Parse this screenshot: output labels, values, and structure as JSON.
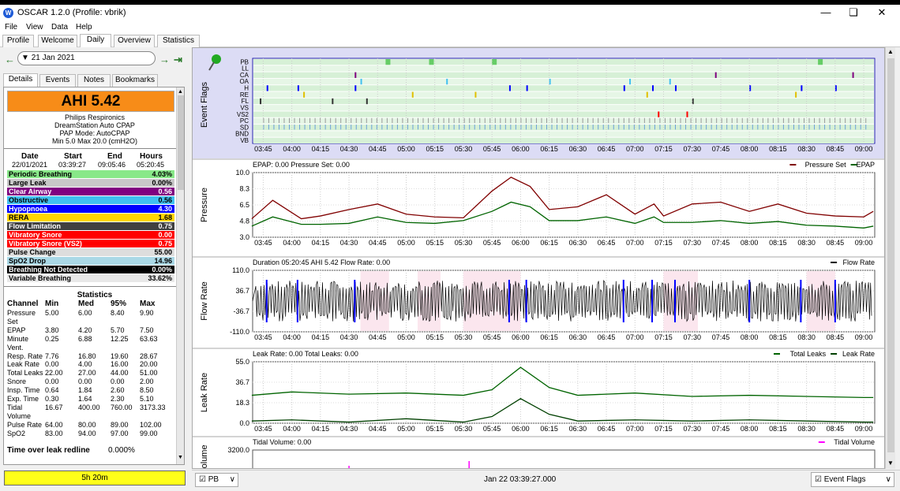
{
  "window": {
    "title": "OSCAR 1.2.0 (Profile: vbrik)",
    "icon": "oscar-app-icon"
  },
  "menu": [
    "File",
    "View",
    "Data",
    "Help"
  ],
  "tabs": [
    "Profile",
    "Welcome",
    "Daily",
    "Overview",
    "Statistics"
  ],
  "active_tab": "Daily",
  "date_nav": {
    "date": "21 Jan 2021"
  },
  "subtabs": [
    "Details",
    "Events",
    "Notes",
    "Bookmarks"
  ],
  "details": {
    "ahi": "AHI 5.42",
    "machine": [
      "Philips Respironics",
      "DreamStation Auto CPAP",
      "PAP Mode: AutoCPAP",
      "Min 5.0 Max 20.0 (cmH2O)"
    ],
    "session_headers": [
      "Date",
      "Start",
      "End",
      "Hours"
    ],
    "session_values": [
      "22/01/2021",
      "03:39:27",
      "09:05:46",
      "05:20:45"
    ],
    "events": [
      {
        "name": "Periodic Breathing",
        "value": "4.03%",
        "bg": "#88e888",
        "fg": "#000000"
      },
      {
        "name": "Large Leak",
        "value": "0.00%",
        "bg": "#c8c8c8",
        "fg": "#000000"
      },
      {
        "name": "Clear Airway",
        "value": "0.56",
        "bg": "#800080",
        "fg": "#ffffff"
      },
      {
        "name": "Obstructive",
        "value": "0.56",
        "bg": "#40c0f0",
        "fg": "#000000"
      },
      {
        "name": "Hypopnoea",
        "value": "4.30",
        "bg": "#0000ff",
        "fg": "#ffffff"
      },
      {
        "name": "RERA",
        "value": "1.68",
        "bg": "#ffd700",
        "fg": "#000000"
      },
      {
        "name": "Flow Limitation",
        "value": "0.75",
        "bg": "#404040",
        "fg": "#ffffff"
      },
      {
        "name": "Vibratory Snore",
        "value": "0.00",
        "bg": "#ff0000",
        "fg": "#ffffff"
      },
      {
        "name": "Vibratory Snore (VS2)",
        "value": "0.75",
        "bg": "#ff0000",
        "fg": "#ffffff"
      },
      {
        "name": "Pulse Change",
        "value": "55.00",
        "bg": "#dddddd",
        "fg": "#000000"
      },
      {
        "name": "SpO2 Drop",
        "value": "14.96",
        "bg": "#aad8e6",
        "fg": "#000000"
      },
      {
        "name": "Breathing Not Detected",
        "value": "0.00%",
        "bg": "#000000",
        "fg": "#ffffff"
      },
      {
        "name": "Variable Breathing",
        "value": "33.62%",
        "bg": "#e8e8e8",
        "fg": "#000000"
      }
    ],
    "statistics_title": "Statistics",
    "stat_headers": [
      "Channel",
      "Min",
      "Med",
      "95%",
      "Max"
    ],
    "stats": [
      {
        "c": "Pressure",
        "min": "5.00",
        "med": "6.00",
        "p95": "8.40",
        "max": "9.90"
      },
      {
        "c": "Set",
        "min": "",
        "med": "",
        "p95": "",
        "max": ""
      },
      {
        "c": "EPAP",
        "min": "3.80",
        "med": "4.20",
        "p95": "5.70",
        "max": "7.50"
      },
      {
        "c": "Minute",
        "min": "0.25",
        "med": "6.88",
        "p95": "12.25",
        "max": "63.63"
      },
      {
        "c": "Vent.",
        "min": "",
        "med": "",
        "p95": "",
        "max": ""
      },
      {
        "c": "Resp. Rate",
        "min": "7.76",
        "med": "16.80",
        "p95": "19.60",
        "max": "28.67"
      },
      {
        "c": "Leak Rate",
        "min": "0.00",
        "med": "4.00",
        "p95": "16.00",
        "max": "20.00"
      },
      {
        "c": "Total Leaks",
        "min": "22.00",
        "med": "27.00",
        "p95": "44.00",
        "max": "51.00"
      },
      {
        "c": "Snore",
        "min": "0.00",
        "med": "0.00",
        "p95": "0.00",
        "max": "2.00"
      },
      {
        "c": "Insp. Time",
        "min": "0.64",
        "med": "1.84",
        "p95": "2.60",
        "max": "8.50"
      },
      {
        "c": "Exp. Time",
        "min": "0.30",
        "med": "1.64",
        "p95": "2.30",
        "max": "5.10"
      },
      {
        "c": "Tidal",
        "min": "16.67",
        "med": "400.00",
        "p95": "760.00",
        "max": "3173.33"
      },
      {
        "c": "Volume",
        "min": "",
        "med": "",
        "p95": "",
        "max": ""
      },
      {
        "c": "Pulse Rate",
        "min": "64.00",
        "med": "80.00",
        "p95": "89.00",
        "max": "102.00"
      },
      {
        "c": "SpO2",
        "min": "83.00",
        "med": "94.00",
        "p95": "97.00",
        "max": "99.00"
      }
    ],
    "leak_redline_label": "Time over leak redline",
    "leak_redline_value": "0.000%",
    "duration": "5h 20m"
  },
  "time_ticks": [
    "03:45",
    "04:00",
    "04:15",
    "04:30",
    "04:45",
    "05:00",
    "05:15",
    "05:30",
    "05:45",
    "06:00",
    "06:15",
    "06:30",
    "06:45",
    "07:00",
    "07:15",
    "07:30",
    "07:45",
    "08:00",
    "08:15",
    "08:30",
    "08:45",
    "09:00"
  ],
  "event_flags": {
    "ylabel": "Event Flags",
    "rows": [
      "PB",
      "LL",
      "CA",
      "OA",
      "H",
      "RE",
      "FL",
      "VS",
      "VS2",
      "PC",
      "SD",
      "BND",
      "VB"
    ]
  },
  "chart_data": [
    {
      "type": "line",
      "ylabel": "Pressure",
      "header_left": "EPAP: 0.00 Pressure Set: 0.00",
      "yticks": [
        "10.0",
        "8.3",
        "6.5",
        "4.8",
        "3.0"
      ],
      "ylim": [
        3.0,
        10.0
      ],
      "x": [
        "03:39",
        "03:50",
        "04:05",
        "04:15",
        "04:30",
        "04:45",
        "05:00",
        "05:15",
        "05:30",
        "05:45",
        "05:55",
        "06:05",
        "06:15",
        "06:30",
        "06:45",
        "07:00",
        "07:10",
        "07:15",
        "07:30",
        "07:45",
        "08:00",
        "08:15",
        "08:30",
        "08:45",
        "09:00",
        "09:05"
      ],
      "series": [
        {
          "name": "Pressure Set",
          "color": "#800000",
          "values": [
            5.0,
            7.0,
            5.0,
            5.3,
            6.0,
            6.6,
            5.5,
            5.2,
            5.1,
            8.0,
            9.5,
            8.5,
            6.0,
            6.3,
            7.6,
            5.5,
            6.6,
            5.3,
            6.6,
            6.8,
            5.8,
            6.6,
            5.6,
            5.3,
            5.2,
            5.8
          ]
        },
        {
          "name": "EPAP",
          "color": "#006400",
          "values": [
            4.2,
            5.2,
            4.4,
            4.4,
            4.5,
            5.2,
            4.6,
            4.5,
            4.8,
            5.8,
            6.8,
            6.3,
            4.8,
            4.8,
            5.2,
            4.5,
            5.2,
            4.6,
            4.6,
            4.8,
            4.5,
            4.7,
            4.3,
            4.2,
            4.0,
            4.2
          ]
        }
      ]
    },
    {
      "type": "line",
      "ylabel": "Flow Rate",
      "header_left": "Duration 05:20:45 AHI 5.42 Flow Rate: 0.00",
      "yticks": [
        "110.0",
        "36.7",
        "-36.7",
        "-110.0"
      ],
      "ylim": [
        -110.0,
        110.0
      ],
      "series": [
        {
          "name": "Flow Rate",
          "color": "#000000"
        }
      ]
    },
    {
      "type": "line",
      "ylabel": "Leak Rate",
      "header_left": "Leak Rate: 0.00 Total Leaks: 0.00",
      "yticks": [
        "55.0",
        "36.7",
        "18.3",
        "0.0"
      ],
      "ylim": [
        0.0,
        55.0
      ],
      "x": [
        "03:39",
        "04:00",
        "04:30",
        "05:00",
        "05:30",
        "05:45",
        "06:00",
        "06:15",
        "06:30",
        "07:00",
        "07:30",
        "08:00",
        "08:30",
        "09:00",
        "09:05"
      ],
      "series": [
        {
          "name": "Total Leaks",
          "color": "#006400",
          "values": [
            25,
            28,
            26,
            27,
            25,
            30,
            50,
            32,
            25,
            27,
            24,
            25,
            24,
            23,
            23
          ]
        },
        {
          "name": "Leak Rate",
          "color": "#004000",
          "values": [
            2,
            3,
            1,
            4,
            1,
            6,
            22,
            8,
            2,
            3,
            2,
            3,
            2,
            1,
            1
          ]
        }
      ]
    },
    {
      "type": "bar",
      "ylabel": "Tidal Volume",
      "header_left": "Tidal Volume: 0.00",
      "yticks": [
        "3200.0"
      ],
      "series": [
        {
          "name": "Tidal Volume",
          "color": "#ff00ff"
        }
      ]
    }
  ],
  "bottom": {
    "combo": "PB",
    "date": "Jan 22 03:39:27.000",
    "event_combo": "Event Flags"
  }
}
